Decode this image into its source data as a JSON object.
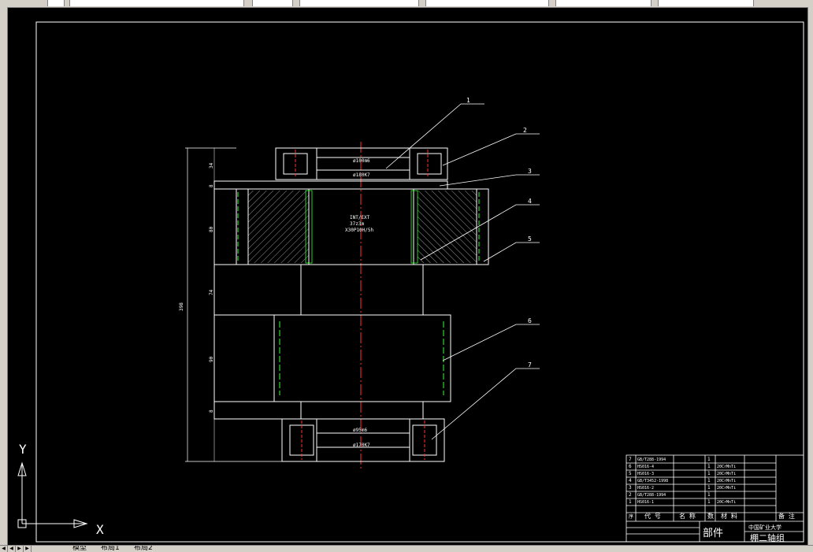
{
  "tabs": [
    {
      "label": "模型"
    },
    {
      "label": "布局1"
    },
    {
      "label": "布局2"
    }
  ],
  "drawing": {
    "part_labels": [
      "1",
      "2",
      "3",
      "4",
      "5",
      "6",
      "7"
    ],
    "dims": {
      "d100": "ø100m6",
      "d180": "ø180K7",
      "spline1": "INT/EXT",
      "spline2": "37z3m",
      "spline3": "X30P10H/5h",
      "d95": "ø95m6",
      "d170": "ø170K7",
      "v34": "34",
      "v8a": "8",
      "v80": "80",
      "v74": "74",
      "v90": "90",
      "v8b": "8",
      "v398": "398"
    }
  },
  "ucs": {
    "x_label": "X",
    "y_label": "Y"
  },
  "title_block": {
    "rows": [
      {
        "no": "7",
        "code": "GB/T288-1994",
        "name": "",
        "qty": "1",
        "mat": ""
      },
      {
        "no": "6",
        "code": "HS016-4",
        "name": "",
        "qty": "1",
        "mat": "20CrMnTi"
      },
      {
        "no": "5",
        "code": "HS016-3",
        "name": "",
        "qty": "1",
        "mat": "20CrMnTi"
      },
      {
        "no": "4",
        "code": "GB/T3452-1998",
        "name": "",
        "qty": "1",
        "mat": "20CrMnTi"
      },
      {
        "no": "3",
        "code": "HS016-2",
        "name": "",
        "qty": "1",
        "mat": "20CrMnTi"
      },
      {
        "no": "2",
        "code": "GB/T288-1994",
        "name": "",
        "qty": "1",
        "mat": ""
      },
      {
        "no": "1",
        "code": "HS016-1",
        "name": "",
        "qty": "1",
        "mat": "20CrMnTi"
      }
    ],
    "header": {
      "seq": "序",
      "code": "代 号",
      "name": "名 称",
      "qty": "数",
      "mat": "材 料",
      "note": "备 注"
    },
    "part_word": "部件",
    "school": "中国矿业大学",
    "assembly": "棚二轴组"
  }
}
